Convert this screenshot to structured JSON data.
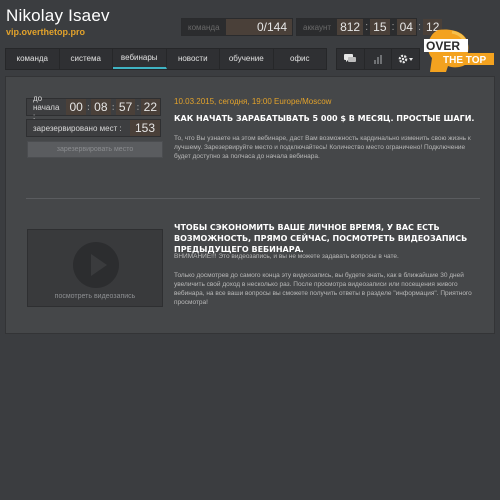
{
  "header": {
    "name": "Nikolay Isaev",
    "link": "vip.overthetop.pro"
  },
  "stats": {
    "team_label": "команда",
    "team_value": "0/144",
    "account_label": "аккаунт",
    "account_segments": [
      "812",
      "15",
      "04",
      "12"
    ]
  },
  "logo": {
    "line1": "OVER",
    "line2": "THE TOP"
  },
  "nav": {
    "items": [
      "команда",
      "система",
      "вебинары",
      "новости",
      "обучение",
      "офис"
    ],
    "active_index": 2
  },
  "toolbar": {
    "icons": [
      "chat-icon",
      "chart-icon",
      "gear-icon"
    ]
  },
  "webinar": {
    "countdown_label": "до начала :",
    "countdown": [
      "00",
      "08",
      "57",
      "22"
    ],
    "reserved_label": "зарезервировано мест :",
    "reserved_value": "153",
    "reserve_button": "зарезервировать место",
    "date": "10.03.2015, сегодня, 19:00 Europe/Moscow",
    "title": "КАК НАЧАТЬ ЗАРАБАТЫВАТЬ 5 000 $ В МЕСЯЦ. ПРОСТЫЕ ШАГИ.",
    "description": "То, что Вы узнаете на этом вебинаре, даст Вам возможность кардинально изменить свою жизнь к лучшему. Зарезервируйте место и подключайтесь! Количество место ограничено! Подключение будет доступно за полчаса до начала вебинара."
  },
  "recording": {
    "video_label": "посмотреть видеозапись",
    "title": "ЧТОБЫ СЭКОНОМИТЬ ВАШЕ ЛИЧНОЕ ВРЕМЯ, У ВАС ЕСТЬ ВОЗМОЖНОСТЬ, ПРЯМО СЕЙЧАС, ПОСМОТРЕТЬ ВИДЕОЗАПИСЬ ПРЕДЫДУЩЕГО ВЕБИНАРА.",
    "note": "ВНИМАНИЕ!!! Это видеозапись, и вы не можете задавать вопросы в чате.",
    "body": "Только досмотрев до самого конца эту видеозапись, вы будете знать, как в ближайшие 30 дней увеличить свой доход в несколько раз. После просмотра видеозаписи или посещения живого вебинара, на все ваши вопросы вы сможете получить ответы в разделе \"информация\". Приятного просмотра!"
  },
  "colors": {
    "accent": "#e2a22b",
    "active_tab": "#3fb3c3",
    "background": "#3b3d40",
    "panel": "#454749"
  }
}
